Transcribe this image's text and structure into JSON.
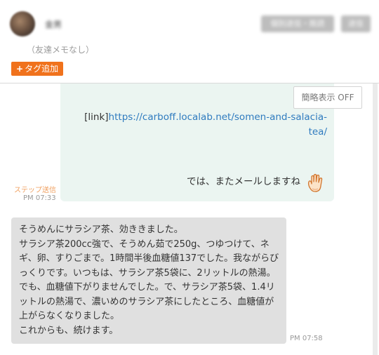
{
  "header": {
    "username": "金男",
    "memo": "（友達メモなし）",
    "tag_button": "タグ追加",
    "tag_button_icon": "plus-icon",
    "action_buttons": [
      "個別送信・既読",
      "送信"
    ]
  },
  "chat": {
    "compact_toggle": "簡略表示 OFF",
    "outgoing": {
      "link_prefix": "[link]",
      "link_url": "https://carboff.localab.net/somen-and-salacia-tea/",
      "closing": "では、またメールしますね",
      "closing_icon": "raised-hand-icon",
      "step_label": "ステップ送信",
      "time": "PM 07:33"
    },
    "incoming": {
      "lines": [
        "そうめんにサラシア茶、効ききました。",
        "サラシア茶200cc強で、そうめん茹で250g、つゆつけて、ネギ、卵、すりごまで。1時間半後血糖値137でした。我ながらびっくりです。いつもは、サラシア茶5袋に、2リットルの熱湯。でも、血糖値下がりませんでした。で、サラシア茶5袋、1.4リットルの熱湯で、濃いめのサラシア茶にしたところ、血糖値が上がらなくなりました。",
        "これからも、続けます。"
      ],
      "time": "PM 07:58"
    }
  },
  "colors": {
    "accent": "#f0721c",
    "link": "#2f7bbf",
    "outgoing_bg": "#ebf5f1",
    "incoming_bg": "#e0e0e0",
    "step_label": "#f0a060"
  }
}
